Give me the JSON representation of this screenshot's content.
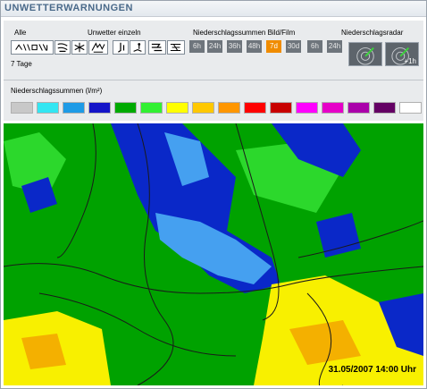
{
  "header": {
    "title": "UNWETTERWARNUNGEN"
  },
  "controls": {
    "all_label": "Alle",
    "single_label": "Unwetter einzeln",
    "precip_label": "Niederschlagssummen Bild/Film",
    "radar_label": "Niederschlagsradar",
    "period_label": "7 Tage",
    "time_buttons": [
      {
        "label": "6h",
        "active": false
      },
      {
        "label": "24h",
        "active": false
      },
      {
        "label": "36h",
        "active": false
      },
      {
        "label": "48h",
        "active": false
      },
      {
        "label": "7d",
        "active": true
      },
      {
        "label": "30d",
        "active": false
      },
      {
        "label": "6h",
        "active": false
      },
      {
        "label": "24h",
        "active": false
      }
    ],
    "warning_icons": [
      "all-warnings-icon",
      "storm-icon",
      "snow-icon",
      "thunderstorm-icon",
      "rain-icon",
      "heat-icon",
      "wind-icon",
      "fog-icon"
    ],
    "radar_buttons": [
      {
        "name": "radar-now-button",
        "label": ""
      },
      {
        "name": "radar-forecast-button",
        "label": "+1h"
      }
    ]
  },
  "legend": {
    "title": "Niederschlagssummen (l/m²)",
    "colors": [
      "#c8c8c8",
      "#33e6f2",
      "#1e9be6",
      "#1414c8",
      "#00aa00",
      "#32f032",
      "#ffff00",
      "#ffc800",
      "#ff9600",
      "#ff0000",
      "#c80000",
      "#ff00ff",
      "#e600c8",
      "#aa00aa",
      "#640064",
      "#ffffff"
    ]
  },
  "map": {
    "timestamp": "31.05/2007 14:00 Uhr",
    "colors": {
      "green": "#00a200",
      "light_green": "#2cd82c",
      "dark_blue": "#0a28c8",
      "light_blue": "#45a0f0",
      "yellow": "#f8f000",
      "orange": "#f4b000"
    }
  }
}
